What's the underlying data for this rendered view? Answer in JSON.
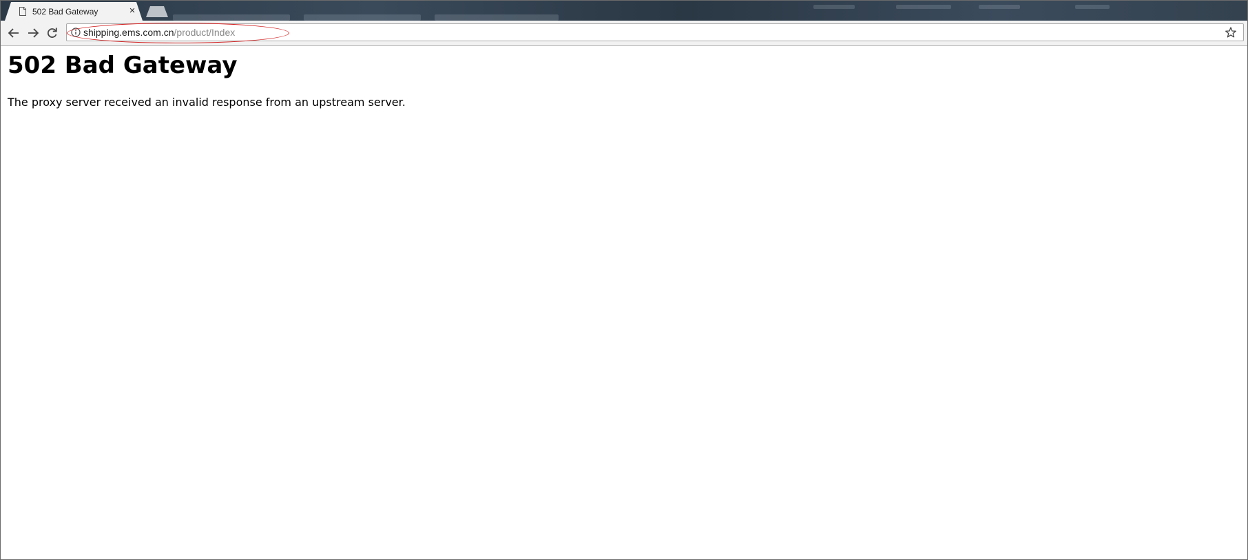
{
  "browser": {
    "tab": {
      "title": "502 Bad Gateway",
      "close_glyph": "×",
      "icon": "document-icon"
    },
    "toolbar": {
      "back_icon": "arrow-left-icon",
      "forward_icon": "arrow-right-icon",
      "reload_icon": "reload-icon",
      "site_info_icon": "info-icon",
      "bookmark_icon": "star-icon"
    },
    "address": {
      "host": "shipping.ems.com.cn",
      "path": "/product/Index"
    },
    "highlight_color": "#d21f1f"
  },
  "page": {
    "heading": "502 Bad Gateway",
    "message": "The proxy server received an invalid response from an upstream server."
  }
}
